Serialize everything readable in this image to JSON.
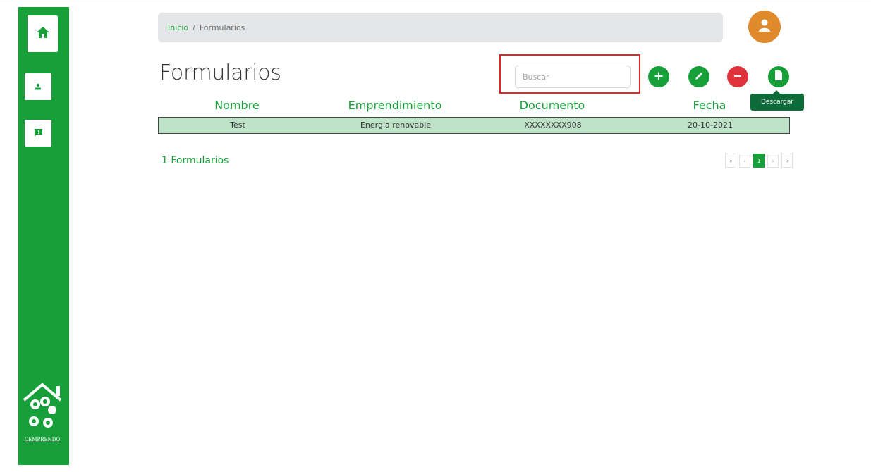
{
  "breadcrumb": {
    "home": "Inicio",
    "separator": "/",
    "current": "Formularios"
  },
  "page": {
    "title": "Formularios"
  },
  "search": {
    "placeholder": "Buscar"
  },
  "actions": {
    "add_icon": "plus-icon",
    "edit_icon": "pencil-icon",
    "remove_icon": "minus-icon",
    "download_icon": "file-icon",
    "download_tooltip": "Descargar"
  },
  "table": {
    "columns": [
      "Nombre",
      "Emprendimiento",
      "Documento",
      "Fecha"
    ],
    "rows": [
      [
        "Test",
        "Energia renovable",
        "XXXXXXXX908",
        "20-10-2021"
      ]
    ]
  },
  "footer": {
    "count_label": "1 Formularios"
  },
  "pagination": {
    "first": "«",
    "prev": "‹",
    "current": "1",
    "next": "›",
    "last": "»"
  },
  "sidebar": {
    "items": [
      {
        "icon": "home-icon"
      },
      {
        "icon": "user-icon"
      },
      {
        "icon": "feedback-icon"
      }
    ],
    "logo_text": "CEMPRENDO"
  },
  "colors": {
    "brand_green": "#17a039",
    "row_highlight": "#bfe3c8",
    "danger_red": "#e0323b",
    "avatar_orange": "#e08a2e",
    "tooltip_bg": "#0d6b3a"
  }
}
